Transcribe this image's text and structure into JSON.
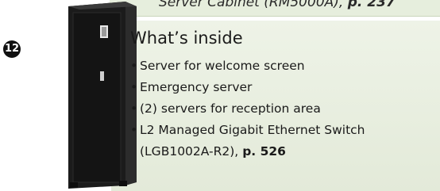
{
  "caption": {
    "label": "Server Cabinet (RM5000A),",
    "page_ref": "p. 237"
  },
  "callout": {
    "number": "12"
  },
  "inside": {
    "heading": "What’s inside",
    "items": [
      {
        "text": "Server for welcome screen"
      },
      {
        "text": "Emergency server"
      },
      {
        "text": "(2) servers for reception area"
      },
      {
        "text": "L2 Managed Gigabit Ethernet Switch",
        "continuation": "(LGB1002A-R2),",
        "page_ref": "p. 526"
      }
    ]
  },
  "colors": {
    "panel": "#e6eedd",
    "cabinet": "#1b1b1b",
    "callout": "#111111"
  }
}
